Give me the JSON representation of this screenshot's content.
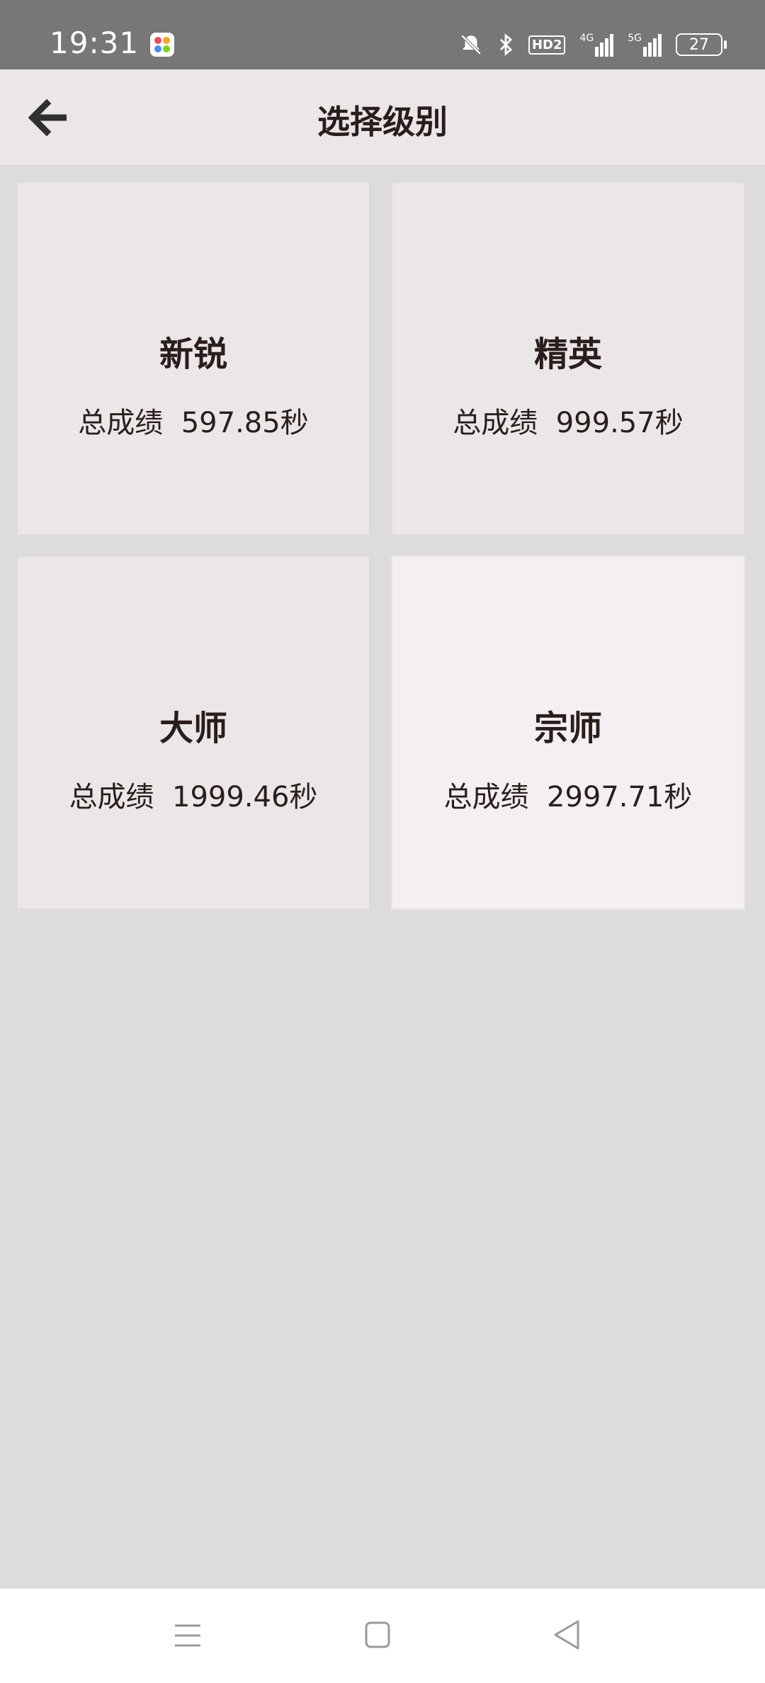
{
  "status": {
    "time": "19:31",
    "battery": "27",
    "network_4g": "4G",
    "network_5g": "5G",
    "hd": "HD2"
  },
  "header": {
    "title": "选择级别"
  },
  "levels": [
    {
      "name": "新锐",
      "score_label": "总成绩",
      "score_value": "597.85秒"
    },
    {
      "name": "精英",
      "score_label": "总成绩",
      "score_value": "999.57秒"
    },
    {
      "name": "大师",
      "score_label": "总成绩",
      "score_value": "1999.46秒"
    },
    {
      "name": "宗师",
      "score_label": "总成绩",
      "score_value": "2997.71秒"
    }
  ],
  "colors": {
    "background": "#dcdbdd",
    "appbar": "#ebe7e8",
    "card": "#ebe7e8",
    "card_highlight": "#f3eff2",
    "text": "#2a1e1c",
    "statusbar": "#777777"
  },
  "icons": {
    "back": "arrow-left-icon",
    "nav_menu": "menu-icon",
    "nav_home": "square-home-icon",
    "nav_back": "triangle-back-icon"
  }
}
